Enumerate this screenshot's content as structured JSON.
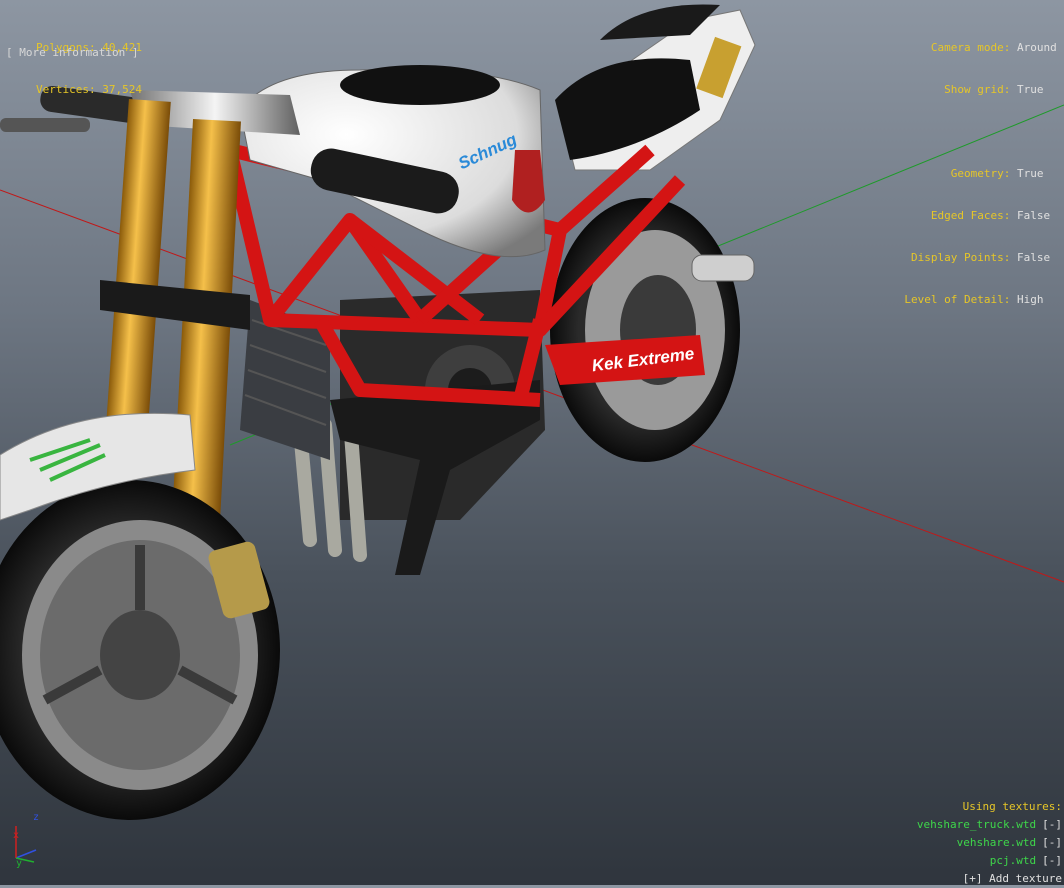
{
  "stats": {
    "polygons_label": "Polygons:",
    "polygons_value": "40,421",
    "vertices_label": "Vertices:",
    "vertices_value": "37,524",
    "more_info": "[ More information ]"
  },
  "settings": {
    "camera_mode_label": "Camera mode:",
    "camera_mode_value": "Around",
    "show_grid_label": "Show grid:",
    "show_grid_value": "True",
    "geometry_label": "Geometry:",
    "geometry_value": "True",
    "edged_faces_label": "Edged Faces:",
    "edged_faces_value": "False",
    "display_points_label": "Display Points:",
    "display_points_value": "False",
    "lod_label": "Level of Detail:",
    "lod_value": "High"
  },
  "textures": {
    "title": "Using textures:",
    "items": [
      {
        "name": "vehshare_truck.wtd",
        "action": "[-]"
      },
      {
        "name": "vehshare.wtd",
        "action": "[-]"
      },
      {
        "name": "pcj.wtd",
        "action": "[-]"
      }
    ],
    "add_label": "[+] Add texture"
  },
  "model": {
    "tank_logo": "Schnug",
    "swingarm_logo": "Kek Extreme"
  },
  "gizmo": {
    "z_label": "z",
    "x_label": "x",
    "y_label": "y"
  },
  "colors": {
    "hud_key": "#e6c628",
    "hud_value": "#e0e0e0",
    "texture_name": "#3ed64a",
    "frame_red": "#d41414",
    "fork_gold": "#d99a1c"
  }
}
